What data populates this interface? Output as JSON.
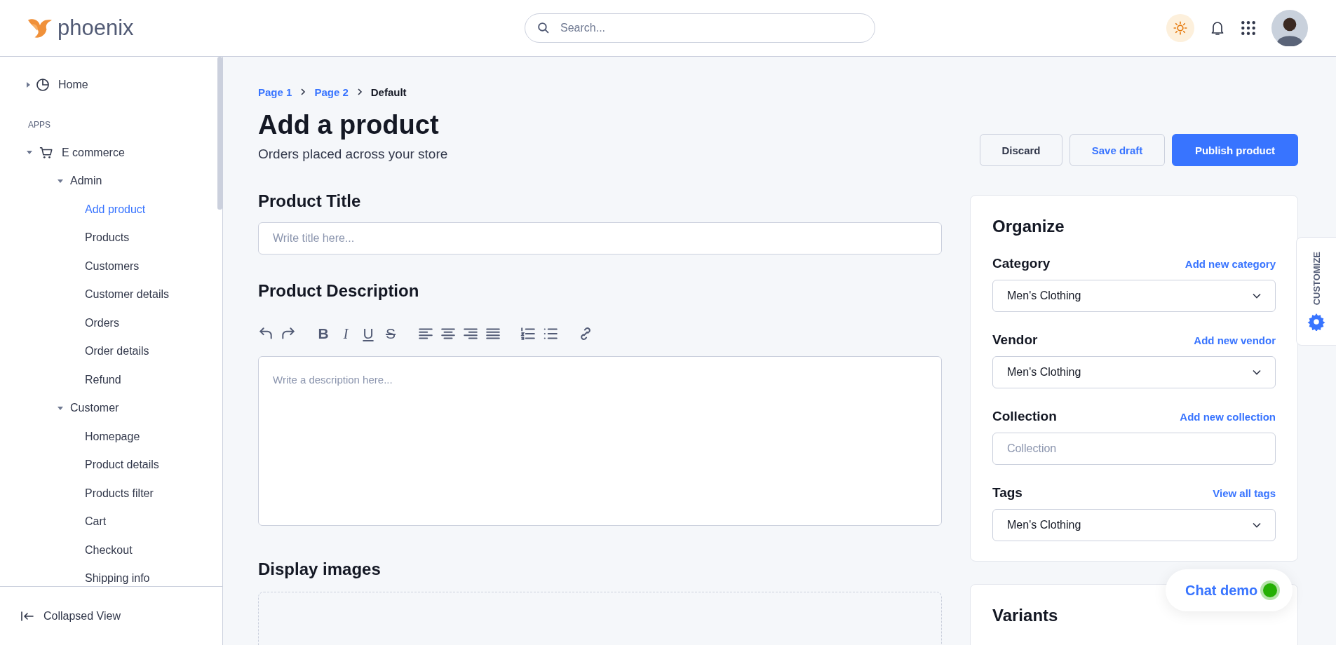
{
  "header": {
    "logo": "phoenix",
    "search": {
      "placeholder": "Search..."
    }
  },
  "sidebar": {
    "items": [
      {
        "label": "Home",
        "expanded": false,
        "selected": false
      },
      {
        "kind": "section",
        "label": "APPS"
      },
      {
        "label": "E commerce",
        "expanded": true,
        "selected": false,
        "children": [
          {
            "label": "Admin",
            "expanded": true,
            "selected": false,
            "children": [
              {
                "label": "Add product",
                "selected": true
              },
              {
                "label": "Products",
                "selected": false
              },
              {
                "label": "Customers",
                "selected": false
              },
              {
                "label": "Customer details",
                "selected": false
              },
              {
                "label": "Orders",
                "selected": false
              },
              {
                "label": "Order details",
                "selected": false
              },
              {
                "label": "Refund",
                "selected": false
              }
            ]
          },
          {
            "label": "Customer",
            "expanded": true,
            "selected": false,
            "children": [
              {
                "label": "Homepage",
                "selected": false
              },
              {
                "label": "Product details",
                "selected": false
              },
              {
                "label": "Products filter",
                "selected": false
              },
              {
                "label": "Cart",
                "selected": false
              },
              {
                "label": "Checkout",
                "selected": false
              },
              {
                "label": "Shipping info",
                "selected": false
              }
            ]
          }
        ]
      }
    ],
    "footer": "Collapsed View"
  },
  "breadcrumb": [
    "Page 1",
    "Page 2",
    "Default"
  ],
  "page": {
    "title": "Add a product",
    "subtitle": "Orders placed across your store",
    "buttons": [
      {
        "label": "Discard",
        "kind": "plain"
      },
      {
        "label": "Save draft",
        "kind": "link"
      },
      {
        "label": "Publish product",
        "kind": "primary"
      }
    ]
  },
  "product_title": {
    "heading": "Product Title",
    "placeholder": "Write title here..."
  },
  "description": {
    "heading": "Product Description",
    "format_buttons": [
      "B",
      "I",
      "U",
      "S"
    ],
    "placeholder": "Write a description here..."
  },
  "display_images": {
    "heading": "Display images"
  },
  "organize": {
    "title": "Organize",
    "fields": [
      {
        "label": "Category",
        "link": "Add new category",
        "kind": "select",
        "value": "Men's Clothing"
      },
      {
        "label": "Vendor",
        "link": "Add new vendor",
        "kind": "select",
        "value": "Men's Clothing"
      },
      {
        "label": "Collection",
        "link": "Add new collection",
        "kind": "input",
        "placeholder": "Collection"
      },
      {
        "label": "Tags",
        "link": "View all tags",
        "kind": "select",
        "value": "Men's Clothing"
      }
    ]
  },
  "variants": {
    "title": "Variants"
  },
  "customize_tab": "CUSTOMIZE",
  "chat": {
    "label": "Chat demo",
    "online": true
  }
}
